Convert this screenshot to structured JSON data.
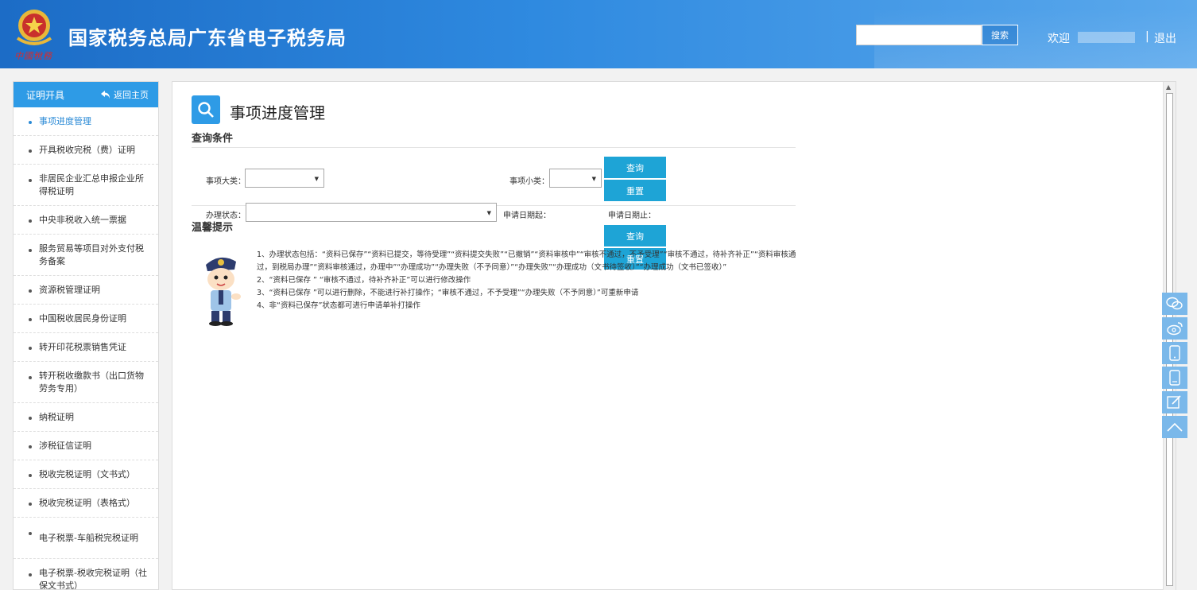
{
  "header": {
    "emblem_text": "中國稅務",
    "title": "国家税务总局广东省电子税务局",
    "search_button": "搜索",
    "welcome": "欢迎",
    "separator": "|",
    "logout": "退出"
  },
  "sidebar": {
    "title": "证明开具",
    "back_home": "返回主页",
    "items": [
      {
        "label": "事项进度管理"
      },
      {
        "label": "开具税收完税（费）证明"
      },
      {
        "label": "非居民企业汇总申报企业所得税证明"
      },
      {
        "label": "中央非税收入统一票据"
      },
      {
        "label": "服务贸易等项目对外支付税务备案"
      },
      {
        "label": "资源税管理证明"
      },
      {
        "label": "中国税收居民身份证明"
      },
      {
        "label": "转开印花税票销售凭证"
      },
      {
        "label": "转开税收缴款书（出口货物劳务专用）"
      },
      {
        "label": "纳税证明"
      },
      {
        "label": "涉税征信证明"
      },
      {
        "label": "税收完税证明（文书式）"
      },
      {
        "label": "税收完税证明（表格式）"
      },
      {
        "label": "电子税票-车船税完税证明"
      },
      {
        "label": "电子税票-税收完税证明（社保文书式）"
      }
    ]
  },
  "main": {
    "page_title": "事项进度管理",
    "query_section": "查询条件",
    "labels": {
      "category": "事项大类：",
      "subcategory": "事项小类：",
      "status": "办理状态：",
      "date_from": "申请日期起：",
      "date_to": "申请日期止："
    },
    "buttons": {
      "query": "查询",
      "reset": "重置"
    },
    "tips_section": "温馨提示",
    "tips": [
      "1、办理状态包括：“资料已保存”“资料已提交，等待受理”“资料提交失败”“已撤销”“资料审核中”“审核不通过，不予受理”“审核不通过，待补齐补正”“资料审核通过，到税局办理”“资料审核通过，办理中”“办理成功”“办理失败（不予同意）”“办理失败”“办理成功（文书待签收）”“办理成功（文书已签收）”",
      "2、“资料已保存 ” “审核不通过，待补齐补正”可以进行修改操作",
      "3、“资料已保存 ”可以进行删除，不能进行补打操作；“审核不通过，不予受理”“办理失败（不予同意）”可重新申请",
      "4、非“资料已保存”状态都可进行申请单补打操作"
    ]
  },
  "float_toolbar": [
    "wechat-icon",
    "weibo-icon",
    "mobile-icon",
    "tablet-icon",
    "edit-icon",
    "back-to-top-icon"
  ]
}
